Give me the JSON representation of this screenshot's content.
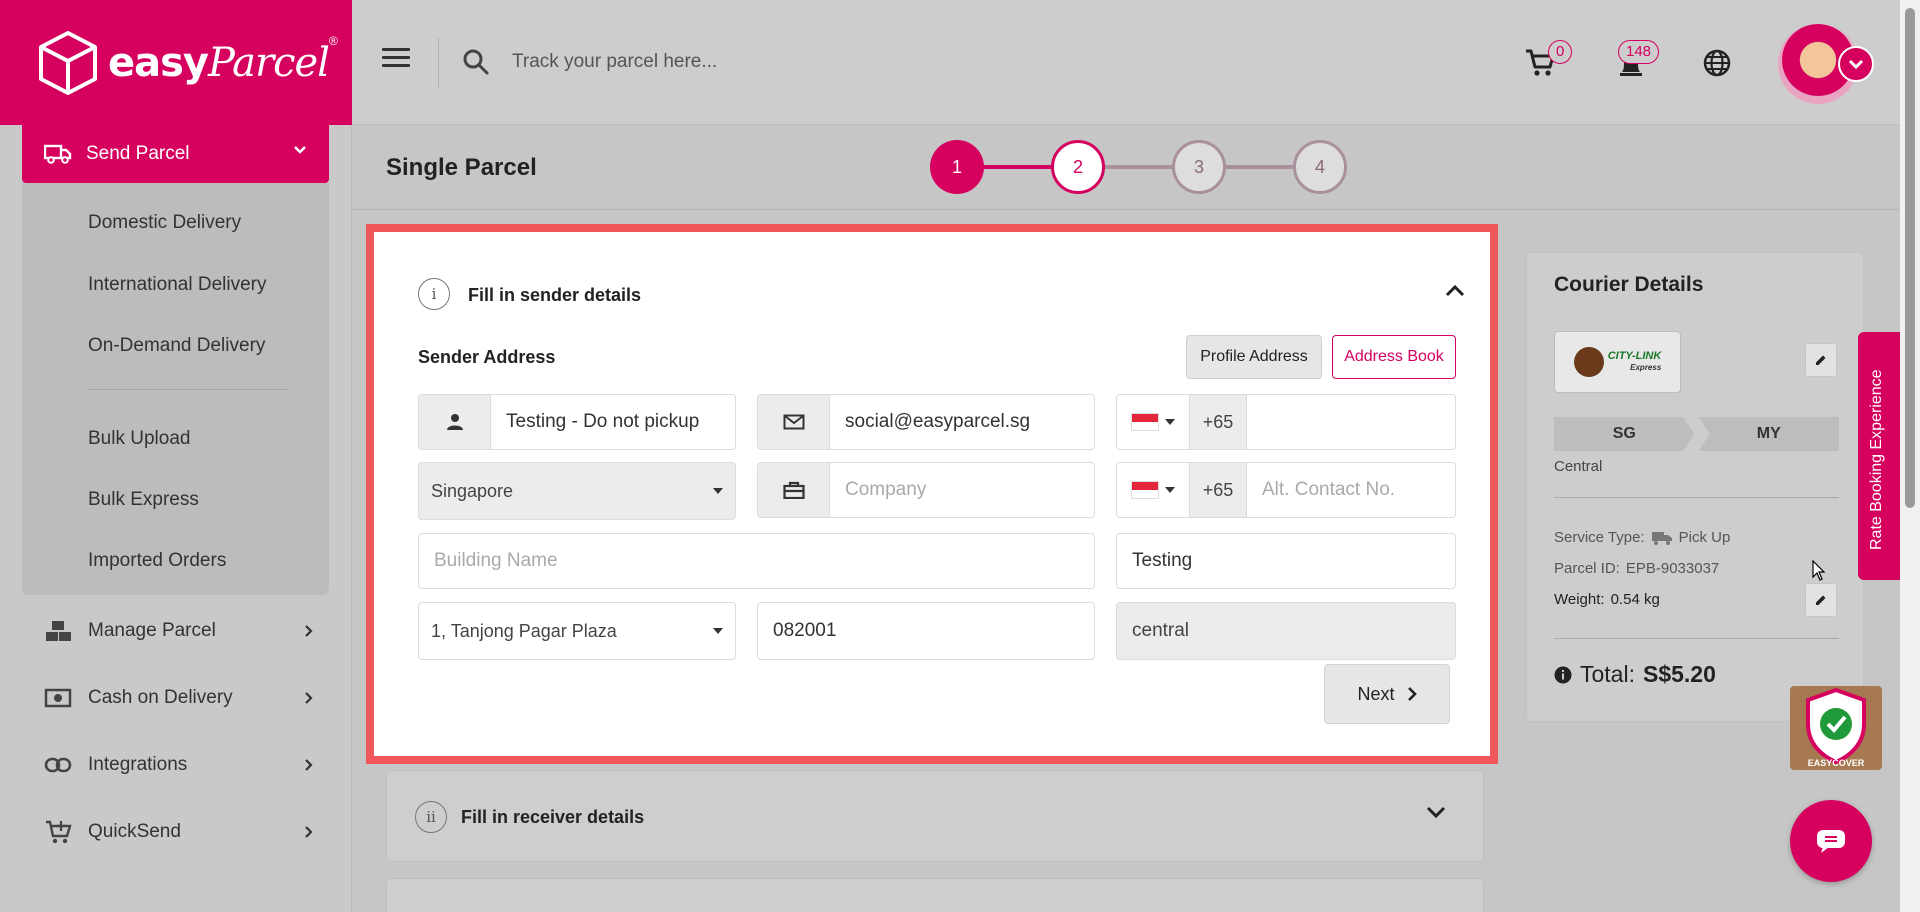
{
  "brand": {
    "name": "easy",
    "name_script": "Parcel",
    "reg": "®",
    "logo_icon": "cube-icon"
  },
  "topbar": {
    "menu_icon": "hamburger-icon",
    "search_icon": "search-icon",
    "track_placeholder": "Track your parcel here...",
    "cart_count": "0",
    "notification_count": "148",
    "language_icon": "globe-icon"
  },
  "sidebar": {
    "send_parcel": "Send Parcel",
    "submenu": [
      "Domestic Delivery",
      "International Delivery",
      "On-Demand Delivery",
      "Bulk Upload",
      "Bulk Express",
      "Imported Orders"
    ],
    "nav": [
      {
        "label": "Manage Parcel",
        "icon": "boxes-icon"
      },
      {
        "label": "Cash on Delivery",
        "icon": "cash-icon"
      },
      {
        "label": "Integrations",
        "icon": "link-icon"
      },
      {
        "label": "QuickSend",
        "icon": "cart-plus-icon"
      }
    ]
  },
  "page": {
    "title": "Single Parcel",
    "steps": [
      "1",
      "2",
      "3",
      "4"
    ]
  },
  "sender": {
    "section_number": "i",
    "section_title": "Fill in sender details",
    "address_title": "Sender Address",
    "profile_address": "Profile Address",
    "address_book": "Address Book",
    "name_value": "Testing - Do not pickup",
    "email_value": "social@easyparcel.sg",
    "phone_code": "+65",
    "phone_value": "",
    "country_value": "Singapore",
    "company_placeholder": "Company",
    "alt_code": "+65",
    "alt_placeholder": "Alt. Contact No.",
    "building_placeholder": "Building Name",
    "address_value": "Testing",
    "street_value": "1, Tanjong Pagar Plaza",
    "postcode_value": "082001",
    "area_value": "central",
    "next_label": "Next"
  },
  "receiver": {
    "section_number": "ii",
    "section_title": "Fill in receiver details"
  },
  "courier": {
    "title": "Courier Details",
    "logo_text_1": "CITY-LINK",
    "logo_text_2": "Express",
    "from": "SG",
    "to": "MY",
    "region": "Central",
    "service_label": "Service Type:",
    "service_value": "Pick Up",
    "parcel_label": "Parcel ID:",
    "parcel_value": "EPB-9033037",
    "weight_label": "Weight:",
    "weight_value": "0.54 kg",
    "total_label": "Total:",
    "total_value": "S$5.20"
  },
  "rate_tab": "Rate Booking Experience",
  "easycover_label": "EASYCOVER",
  "colors": {
    "brand": "#d6005f",
    "highlight": "#f0575a"
  }
}
